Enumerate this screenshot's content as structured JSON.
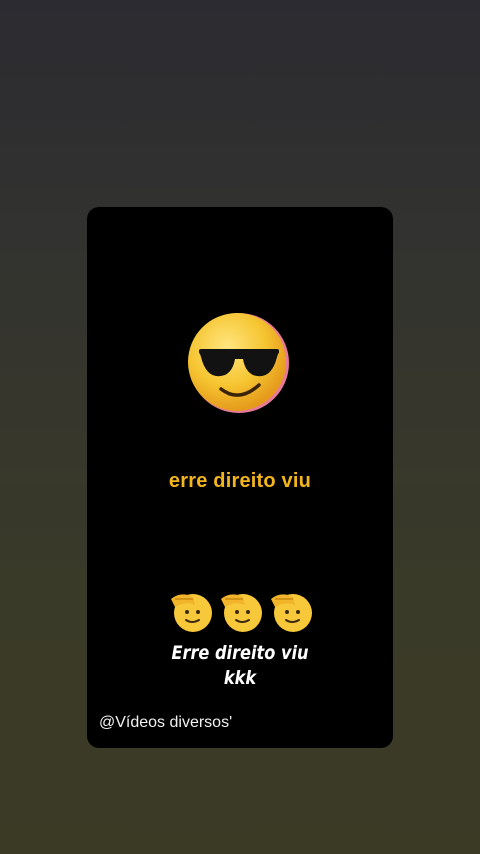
{
  "story": {
    "emoji_main": "smiling-face-with-sunglasses-icon",
    "caption_top": "erre direito viu",
    "salute_icons": [
      "saluting-face-icon",
      "saluting-face-icon",
      "saluting-face-icon"
    ],
    "caption_bottom_line1": "Erre direito viu",
    "caption_bottom_line2": "kkk",
    "watermark": "@Vídeos diversos'"
  },
  "colors": {
    "caption_top": "#f2b51c",
    "card_background": "#000000",
    "page_background": "#33332c"
  }
}
